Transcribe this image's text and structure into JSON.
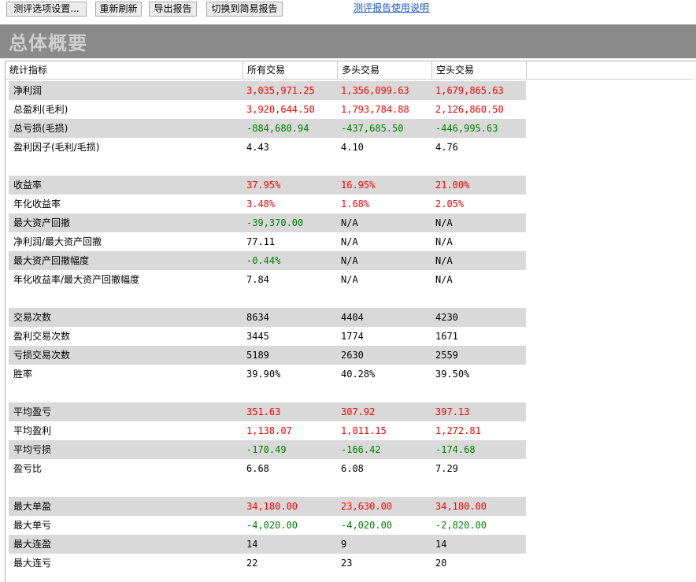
{
  "toolbar": {
    "settings_label": "测评选项设置...",
    "refresh_label": "重新刷新",
    "export_label": "导出报告",
    "switch_label": "切换到简易报告",
    "help_link": "测评报告使用说明"
  },
  "banner": {
    "title": "总体概要"
  },
  "table": {
    "headers": [
      "统计指标",
      "所有交易",
      "多头交易",
      "空头交易"
    ],
    "rows": [
      {
        "label": "净利润",
        "values": [
          "3,035,971.25",
          "1,356,099.63",
          "1,679,865.63"
        ],
        "color": "red"
      },
      {
        "label": "总盈利(毛利)",
        "values": [
          "3,920,644.50",
          "1,793,784.88",
          "2,126,860.50"
        ],
        "color": "red"
      },
      {
        "label": "总亏损(毛损)",
        "values": [
          "-884,680.94",
          "-437,685.50",
          "-446,995.63"
        ],
        "color": "green"
      },
      {
        "label": "盈利因子(毛利/毛损)",
        "values": [
          "4.43",
          "4.10",
          "4.76"
        ],
        "color": "black"
      },
      {
        "label": "收益率",
        "values": [
          "37.95%",
          "16.95%",
          "21.00%"
        ],
        "color": "red"
      },
      {
        "label": "年化收益率",
        "values": [
          "3.48%",
          "1.68%",
          "2.05%"
        ],
        "color": "red"
      },
      {
        "label": "最大资产回撤",
        "values": [
          "-39,370.00",
          "N/A",
          "N/A"
        ],
        "color": "green"
      },
      {
        "label": "净利润/最大资产回撤",
        "values": [
          "77.11",
          "N/A",
          "N/A"
        ],
        "color": "black"
      },
      {
        "label": "最大资产回撤幅度",
        "values": [
          "-0.44%",
          "N/A",
          "N/A"
        ],
        "color": "green"
      },
      {
        "label": "年化收益率/最大资产回撤幅度",
        "values": [
          "7.84",
          "N/A",
          "N/A"
        ],
        "color": "black"
      },
      {
        "label": "交易次数",
        "values": [
          "8634",
          "4404",
          "4230"
        ],
        "color": "black"
      },
      {
        "label": "盈利交易次数",
        "values": [
          "3445",
          "1774",
          "1671"
        ],
        "color": "black"
      },
      {
        "label": "亏损交易次数",
        "values": [
          "5189",
          "2630",
          "2559"
        ],
        "color": "black"
      },
      {
        "label": "胜率",
        "values": [
          "39.90%",
          "40.28%",
          "39.50%"
        ],
        "color": "black"
      },
      {
        "label": "平均盈亏",
        "values": [
          "351.63",
          "307.92",
          "397.13"
        ],
        "color": "red"
      },
      {
        "label": "平均盈利",
        "values": [
          "1,138.07",
          "1,011.15",
          "1,272.81"
        ],
        "color": "red"
      },
      {
        "label": "平均亏损",
        "values": [
          "-170.49",
          "-166.42",
          "-174.68"
        ],
        "color": "green"
      },
      {
        "label": "盈亏比",
        "values": [
          "6.68",
          "6.08",
          "7.29"
        ],
        "color": "black"
      },
      {
        "label": "最大单盈",
        "values": [
          "34,180.00",
          "23,630.00",
          "34,180.00"
        ],
        "color": "red"
      },
      {
        "label": "最大单亏",
        "values": [
          "-4,020.00",
          "-4,020.00",
          "-2,820.00"
        ],
        "color": "green"
      },
      {
        "label": "最大连盈",
        "values": [
          "14",
          "9",
          "14"
        ],
        "color": "black"
      },
      {
        "label": "最大连亏",
        "values": [
          "22",
          "23",
          "20"
        ],
        "color": "black"
      }
    ]
  }
}
